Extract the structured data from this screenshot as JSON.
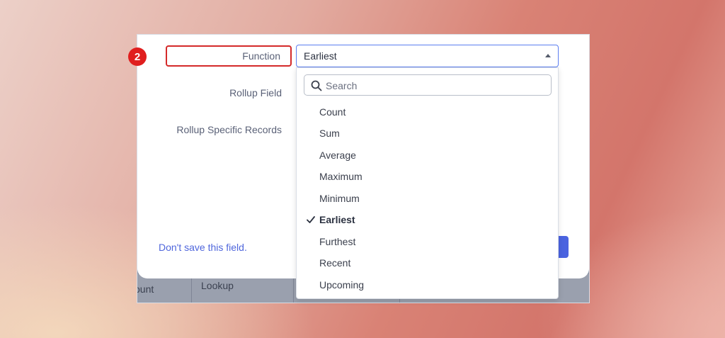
{
  "step_badge": "2",
  "form": {
    "function_label": "Function",
    "rollup_field_label": "Rollup Field",
    "rollup_specific_label": "Rollup Specific Records",
    "function_value": "Earliest",
    "dont_save_link": "Don't save this field."
  },
  "dropdown": {
    "search_placeholder": "Search",
    "options": [
      {
        "label": "Count",
        "selected": false
      },
      {
        "label": "Sum",
        "selected": false
      },
      {
        "label": "Average",
        "selected": false
      },
      {
        "label": "Maximum",
        "selected": false
      },
      {
        "label": "Minimum",
        "selected": false
      },
      {
        "label": "Earliest",
        "selected": true
      },
      {
        "label": "Furthest",
        "selected": false
      },
      {
        "label": "Recent",
        "selected": false
      },
      {
        "label": "Upcoming",
        "selected": false
      }
    ]
  },
  "underlay": {
    "cell1": "ount",
    "cell2": "Lookup"
  },
  "colors": {
    "accent": "#4f66dc",
    "highlight": "#d42a2a",
    "badge": "#e01e1e"
  },
  "icons": {
    "search": "search-icon",
    "caret": "caret-up-icon",
    "check": "check-icon"
  }
}
